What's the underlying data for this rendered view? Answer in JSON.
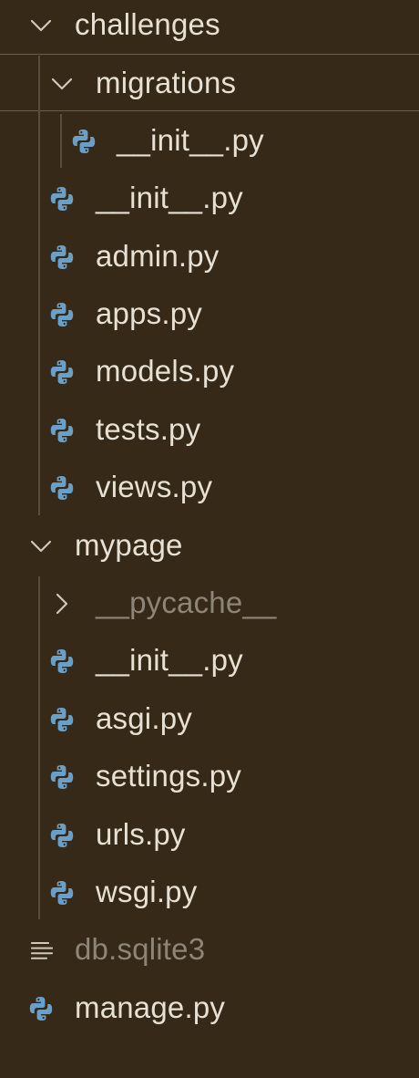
{
  "explorer": {
    "items": [
      {
        "kind": "folder",
        "label": "challenges",
        "expanded": true,
        "depth": 0
      },
      {
        "kind": "folder",
        "label": "migrations",
        "expanded": true,
        "depth": 1,
        "selected": true
      },
      {
        "kind": "python-file",
        "label": "__init__.py",
        "depth": 2
      },
      {
        "kind": "python-file",
        "label": "__init__.py",
        "depth": 1
      },
      {
        "kind": "python-file",
        "label": "admin.py",
        "depth": 1
      },
      {
        "kind": "python-file",
        "label": "apps.py",
        "depth": 1
      },
      {
        "kind": "python-file",
        "label": "models.py",
        "depth": 1
      },
      {
        "kind": "python-file",
        "label": "tests.py",
        "depth": 1
      },
      {
        "kind": "python-file",
        "label": "views.py",
        "depth": 1
      },
      {
        "kind": "folder",
        "label": "mypage",
        "expanded": true,
        "depth": 0
      },
      {
        "kind": "folder",
        "label": "__pycache__",
        "expanded": false,
        "depth": 1,
        "dimmed": true
      },
      {
        "kind": "python-file",
        "label": "__init__.py",
        "depth": 1
      },
      {
        "kind": "python-file",
        "label": "asgi.py",
        "depth": 1
      },
      {
        "kind": "python-file",
        "label": "settings.py",
        "depth": 1
      },
      {
        "kind": "python-file",
        "label": "urls.py",
        "depth": 1
      },
      {
        "kind": "python-file",
        "label": "wsgi.py",
        "depth": 1
      },
      {
        "kind": "text-file",
        "label": "db.sqlite3",
        "depth": 0,
        "dimmed": true
      },
      {
        "kind": "python-file",
        "label": "manage.py",
        "depth": 0
      }
    ]
  },
  "colors": {
    "background": "#362917",
    "text": "#e6e0d5",
    "dimmed_text": "#8d8579",
    "python_blue": "#6a9fc7",
    "chevron": "#cfc8bc",
    "guide_line": "#5b4c39",
    "selection_border": "#6f5d45"
  },
  "icons": {
    "expanded_folder": "chevron-down-icon",
    "collapsed_folder": "chevron-right-icon",
    "python_file": "python-file-icon",
    "text_file": "lines-icon"
  }
}
